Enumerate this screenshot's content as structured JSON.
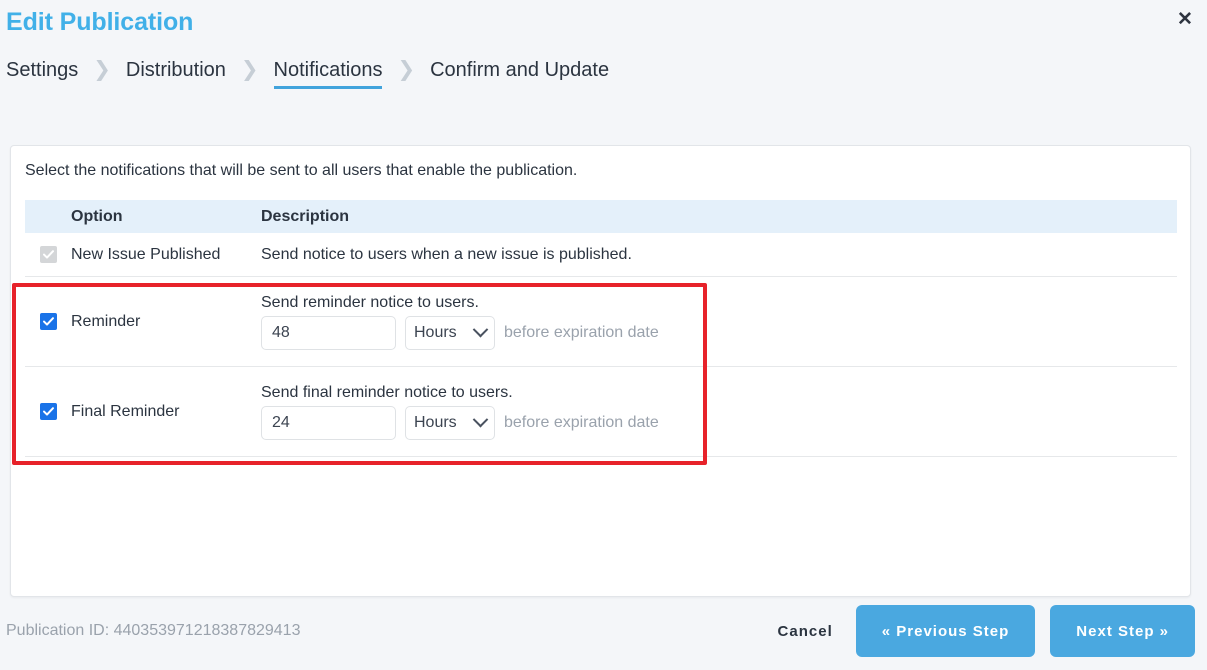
{
  "dialog": {
    "title": "Edit Publication",
    "close_label": "✕"
  },
  "steps": {
    "separator": "❯",
    "items": [
      {
        "label": "Settings",
        "active": false
      },
      {
        "label": "Distribution",
        "active": false
      },
      {
        "label": "Notifications",
        "active": true
      },
      {
        "label": "Confirm and Update",
        "active": false
      }
    ]
  },
  "main": {
    "intro": "Select the notifications that will be sent to all users that enable the publication.",
    "table": {
      "headers": {
        "option": "Option",
        "description": "Description"
      },
      "rows": [
        {
          "option": "New Issue Published",
          "description": "Send notice to users when a new issue is published.",
          "checked": true,
          "disabled": true,
          "has_controls": false
        },
        {
          "option": "Reminder",
          "description": "Send reminder notice to users.",
          "checked": true,
          "disabled": false,
          "has_controls": true,
          "amount": "48",
          "unit": "Hours",
          "suffix": "before expiration date"
        },
        {
          "option": "Final Reminder",
          "description": "Send final reminder notice to users.",
          "checked": true,
          "disabled": false,
          "has_controls": true,
          "amount": "24",
          "unit": "Hours",
          "suffix": "before expiration date"
        }
      ]
    }
  },
  "footer": {
    "publication_id": "Publication ID: 440353971218387829413",
    "cancel_label": "Cancel",
    "previous_label": "« Previous Step",
    "next_label": "Next Step »"
  },
  "colors": {
    "accent": "#41b0e8",
    "button": "#4aa8e0",
    "checkbox_checked": "#1a73e8",
    "checkbox_disabled": "#d4d6d8",
    "annotation": "#e7222a",
    "table_header_bg": "#e4f0fa",
    "page_bg": "#f4f6f9"
  }
}
